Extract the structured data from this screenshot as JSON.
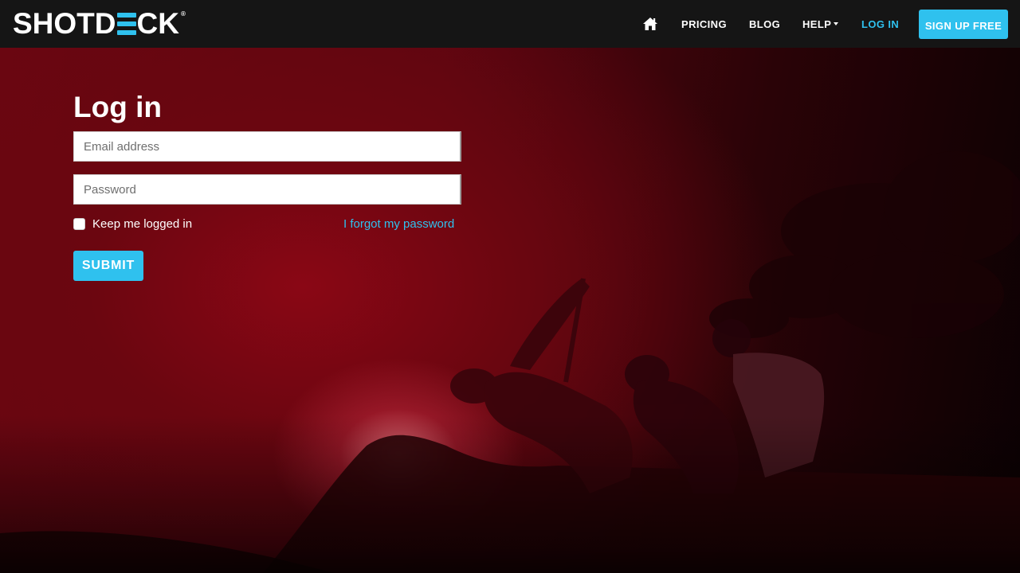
{
  "brand": {
    "name_part1": "SHOTD",
    "name_part2": "CK",
    "registered": "®"
  },
  "nav": {
    "pricing": "PRICING",
    "blog": "BLOG",
    "help": "HELP",
    "login": "LOG IN",
    "signup": "SIGN UP FREE"
  },
  "form": {
    "title": "Log in",
    "email_placeholder": "Email address",
    "email_value": "",
    "password_placeholder": "Password",
    "password_value": "",
    "remember_label": "Keep me logged in",
    "remember_checked": false,
    "forgot_link": "I forgot my password",
    "submit_label": "SUBMIT"
  },
  "colors": {
    "accent": "#2fc1ee",
    "navbar_bg": "#151515",
    "hero_red": "#7a0612"
  },
  "icons": {
    "home": "home-icon",
    "help_caret": "caret-down-icon"
  }
}
